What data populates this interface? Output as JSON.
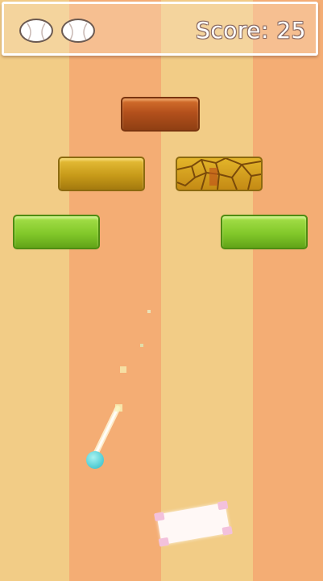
{
  "hud": {
    "score_text": "Score: 25",
    "lives": [
      {
        "icon": "baseball-icon"
      },
      {
        "icon": "baseball-icon"
      }
    ]
  },
  "bricks": [
    {
      "name": "brick-top-brown",
      "color": "brown"
    },
    {
      "name": "brick-left-gold",
      "color": "gold"
    },
    {
      "name": "brick-right-cracked-gold",
      "color": "gold-cracked"
    },
    {
      "name": "brick-left-green",
      "color": "green"
    },
    {
      "name": "brick-right-green",
      "color": "green"
    }
  ],
  "colors": {
    "stripe_light": "#f2cc86",
    "stripe_dark": "#f4ad74",
    "ball": "#5ad0d6",
    "paddle": "#fff8f6",
    "paddle_corners": "#f3c1dc"
  }
}
